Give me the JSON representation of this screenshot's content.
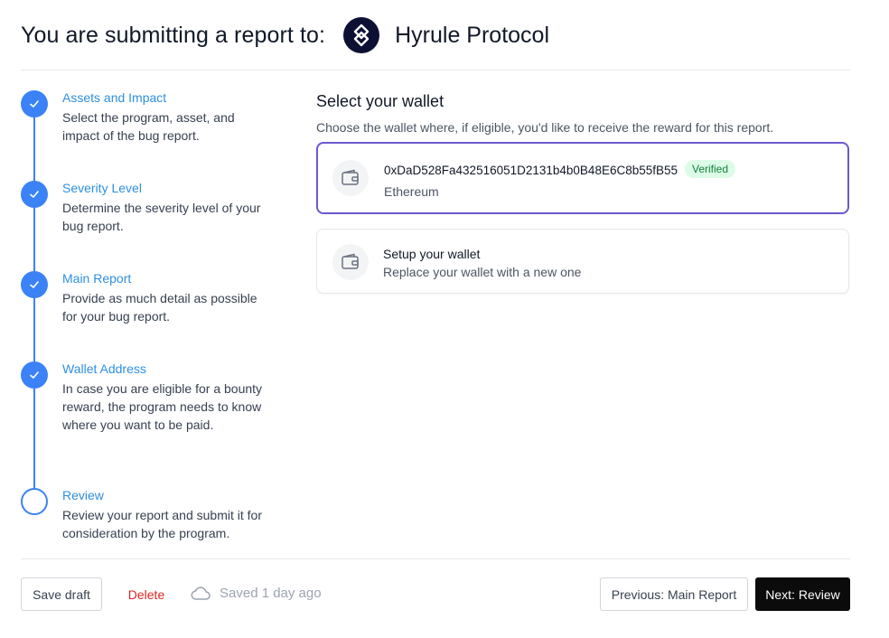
{
  "header": {
    "title": "You are submitting a report to:",
    "program_name": "Hyrule Protocol"
  },
  "steps": [
    {
      "title": "Assets and Impact",
      "description": "Select the program, asset, and impact of the bug report.",
      "status": "complete"
    },
    {
      "title": "Severity Level",
      "description": "Determine the severity level of your bug report.",
      "status": "complete"
    },
    {
      "title": "Main Report",
      "description": "Provide as much detail as possible for your bug report.",
      "status": "complete"
    },
    {
      "title": "Wallet Address",
      "description": "In case you are eligible for a bounty reward, the program needs to know where you want to be paid.",
      "status": "complete"
    },
    {
      "title": "Review",
      "description": "Review your report and submit it for consideration by the program.",
      "status": "pending"
    }
  ],
  "main": {
    "title": "Select your wallet",
    "subtitle": "Choose the wallet where, if eligible, you'd like to receive the reward for this report."
  },
  "wallet": {
    "address": "0xDaD528Fa432516051D2131b4b0B48E6C8b55fB55",
    "badge": "Verified",
    "network": "Ethereum"
  },
  "setup": {
    "title": "Setup your wallet",
    "description": "Replace your wallet with a new one"
  },
  "footer": {
    "save_label": "Save draft",
    "delete_label": "Delete",
    "saved_status": "Saved 1 day ago",
    "prev_label": "Previous: Main Report",
    "next_label": "Next: Review"
  },
  "colors": {
    "accent": "#3b82f6",
    "step_title": "#2f8fe0",
    "selected_border": "#6a5ad0",
    "verified_bg": "#dcfce7",
    "verified_text": "#15803d",
    "delete": "#dc2626",
    "primary_button": "#0b0b0b",
    "logo_bg": "#0c1033"
  },
  "icons": {
    "logo": "hyrule-diamond-logo-icon",
    "step_complete": "check-icon",
    "wallet": "wallet-icon",
    "saved": "cloud-icon"
  }
}
